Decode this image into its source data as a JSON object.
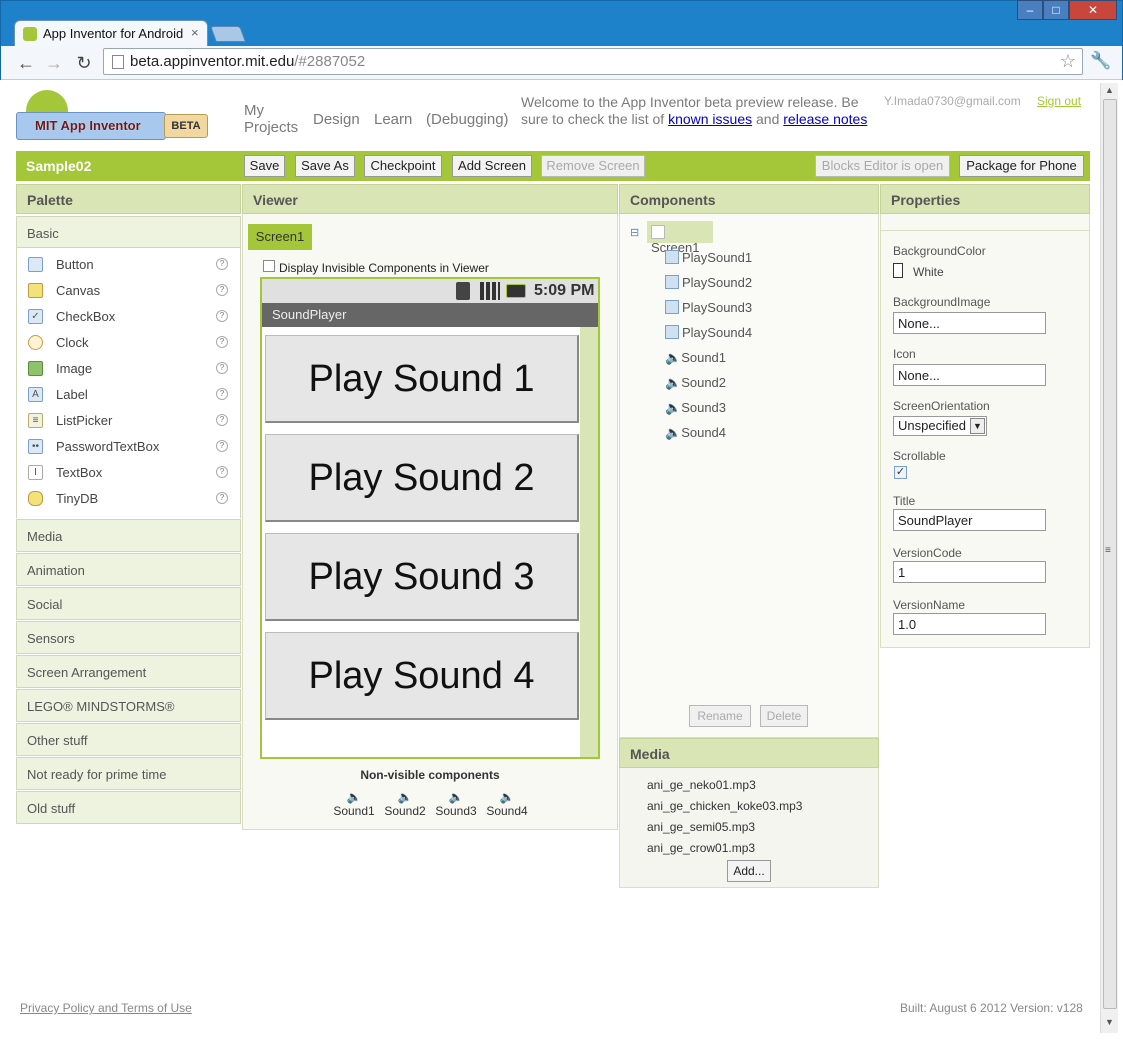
{
  "browser": {
    "tab_title": "App Inventor for Android",
    "url_host": "beta.appinventor.mit.edu",
    "url_rest": "/#2887052"
  },
  "header": {
    "logo_text": "MIT App Inventor",
    "beta_badge": "BETA",
    "nav": [
      "My Projects",
      "Design",
      "Learn",
      "(Debugging)"
    ],
    "welcome_text": "Welcome to the App Inventor beta preview release. Be sure to check the list of",
    "known_issues": "known issues",
    "and_text": "and",
    "release_notes": "release notes",
    "email": "Y.Imada0730@gmail.com",
    "sign_out": "Sign out"
  },
  "project": {
    "name": "Sample02",
    "buttons": {
      "save": "Save",
      "save_as": "Save As",
      "checkpoint": "Checkpoint",
      "add_screen": "Add Screen",
      "remove_screen": "Remove Screen",
      "blocks_editor": "Blocks Editor is open",
      "package": "Package for Phone"
    }
  },
  "palette": {
    "title": "Palette",
    "basic": "Basic",
    "items": [
      "Button",
      "Canvas",
      "CheckBox",
      "Clock",
      "Image",
      "Label",
      "ListPicker",
      "PasswordTextBox",
      "TextBox",
      "TinyDB"
    ],
    "help_glyph": "?",
    "sections": [
      "Media",
      "Animation",
      "Social",
      "Sensors",
      "Screen Arrangement",
      "LEGO® MINDSTORMS®",
      "Other stuff",
      "Not ready for prime time",
      "Old stuff"
    ]
  },
  "viewer": {
    "title": "Viewer",
    "screen_tab": "Screen1",
    "display_invisible": "Display Invisible Components in Viewer",
    "time": "5:09 PM",
    "app_title": "SoundPlayer",
    "buttons": [
      "Play Sound 1",
      "Play Sound 2",
      "Play Sound 3",
      "Play Sound 4"
    ],
    "nonvisible_title": "Non-visible components",
    "nonvisible": [
      "Sound1",
      "Sound2",
      "Sound3",
      "Sound4"
    ]
  },
  "components": {
    "title": "Components",
    "root": "Screen1",
    "children": [
      "PlaySound1",
      "PlaySound2",
      "PlaySound3",
      "PlaySound4",
      "Sound1",
      "Sound2",
      "Sound3",
      "Sound4"
    ],
    "rename": "Rename",
    "delete": "Delete"
  },
  "media": {
    "title": "Media",
    "files": [
      "ani_ge_neko01.mp3",
      "ani_ge_chicken_koke03.mp3",
      "ani_ge_semi05.mp3",
      "ani_ge_crow01.mp3"
    ],
    "add": "Add..."
  },
  "properties": {
    "title": "Properties",
    "background_color_label": "BackgroundColor",
    "background_color_value": "White",
    "background_image_label": "BackgroundImage",
    "background_image_value": "None...",
    "icon_label": "Icon",
    "icon_value": "None...",
    "orientation_label": "ScreenOrientation",
    "orientation_value": "Unspecified",
    "scrollable_label": "Scrollable",
    "scrollable_checked": true,
    "title_label": "Title",
    "title_value": "SoundPlayer",
    "version_code_label": "VersionCode",
    "version_code_value": "1",
    "version_name_label": "VersionName",
    "version_name_value": "1.0"
  },
  "footer": {
    "privacy": "Privacy Policy and Terms of Use",
    "built": "Built: August 6 2012 Version: v128"
  },
  "colors": {
    "accent_green": "#a4c639",
    "panel_header": "#d9e5b4",
    "link_blue": "#0000cc"
  }
}
